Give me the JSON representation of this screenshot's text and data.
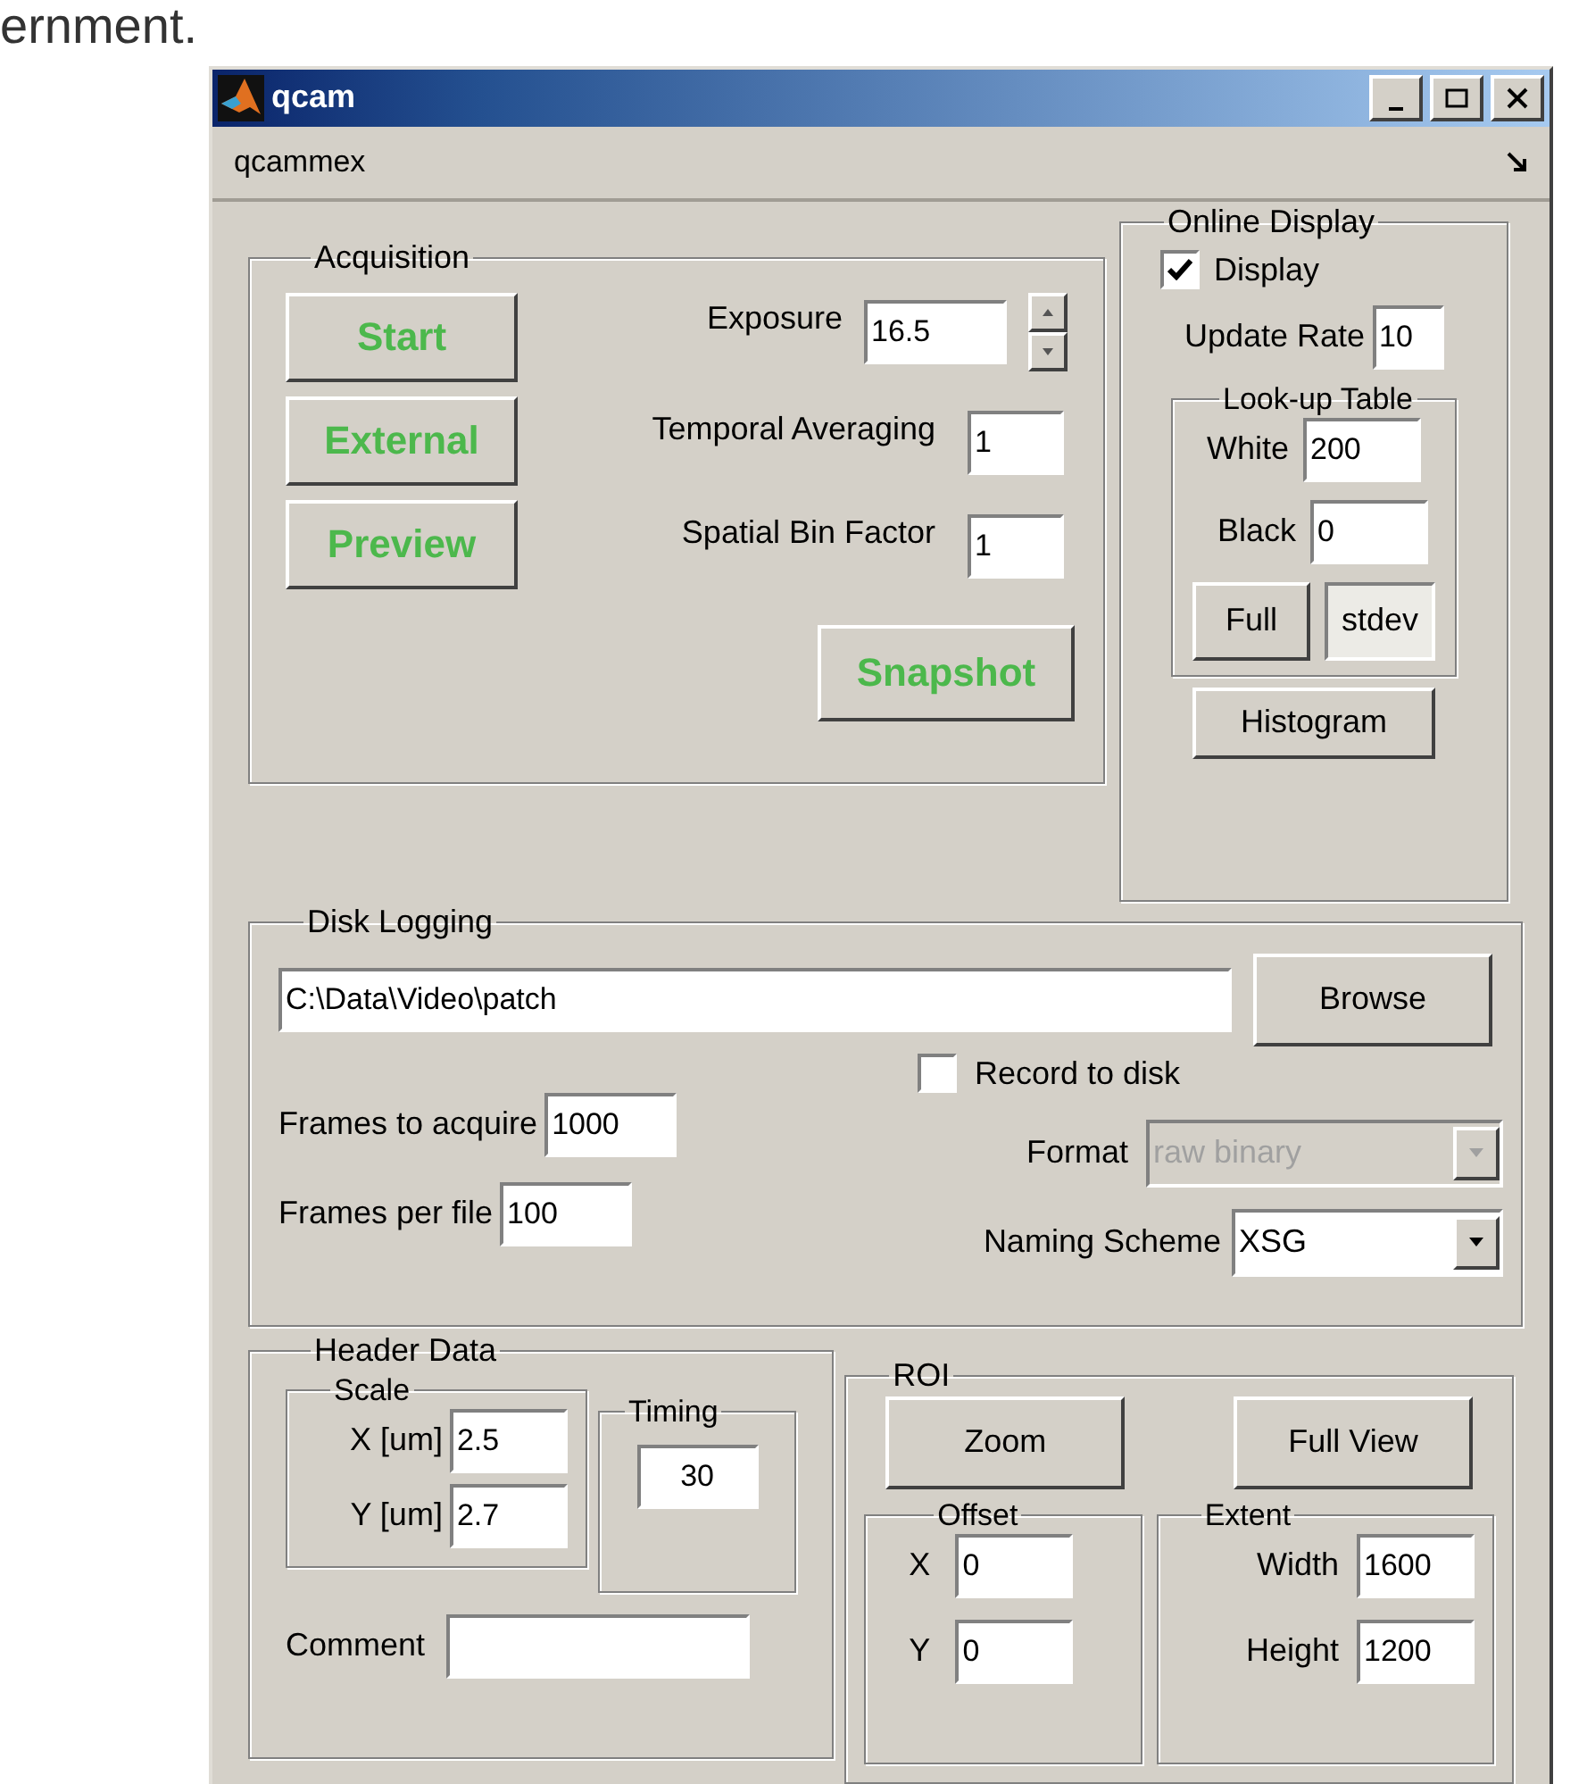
{
  "caption": "ernment.",
  "window": {
    "title": "qcam",
    "menu": "qcammex"
  },
  "acquisition": {
    "title": "Acquisition",
    "buttons": [
      "Start",
      "External",
      "Preview"
    ],
    "exposure": {
      "label": "Exposure",
      "value": "16.5"
    },
    "temporal_averaging": {
      "label": "Temporal Averaging",
      "value": "1"
    },
    "spatial_bin": {
      "label": "Spatial Bin Factor",
      "value": "1"
    },
    "snapshot": "Snapshot"
  },
  "online_display": {
    "title": "Online Display",
    "display": {
      "label": "Display",
      "checked": true
    },
    "update_rate": {
      "label": "Update Rate",
      "value": "10"
    },
    "lut": {
      "title": "Look-up Table",
      "white": {
        "label": "White",
        "value": "200"
      },
      "black": {
        "label": "Black",
        "value": "0"
      },
      "full": "Full",
      "stdev": {
        "label": "stdev",
        "pressed": true
      }
    },
    "histogram": "Histogram"
  },
  "disk_logging": {
    "title": "Disk Logging",
    "path": "C:\\Data\\Video\\patch",
    "browse": "Browse",
    "record": {
      "label": "Record to disk",
      "checked": false
    },
    "frames_to_acquire": {
      "label": "Frames to acquire",
      "value": "1000"
    },
    "format": {
      "label": "Format",
      "value": "raw binary",
      "disabled": true
    },
    "frames_per_file": {
      "label": "Frames per file",
      "value": "100"
    },
    "naming": {
      "label": "Naming Scheme",
      "value": "XSG",
      "disabled": false
    }
  },
  "header_data": {
    "title": "Header Data",
    "scale": {
      "title": "Scale",
      "x": {
        "label": "X [um]",
        "value": "2.5"
      },
      "y": {
        "label": "Y [um]",
        "value": "2.7"
      }
    },
    "timing": {
      "title": "Timing",
      "value": "30"
    },
    "comment": {
      "label": "Comment"
    }
  },
  "roi": {
    "title": "ROI",
    "zoom": "Zoom",
    "full_view": "Full View",
    "offset": {
      "title": "Offset",
      "x": {
        "label": "X",
        "value": "0"
      },
      "y": {
        "label": "Y",
        "value": "0"
      }
    },
    "extent": {
      "title": "Extent",
      "width": {
        "label": "Width",
        "value": "1600"
      },
      "height": {
        "label": "Height",
        "value": "1200"
      }
    }
  }
}
